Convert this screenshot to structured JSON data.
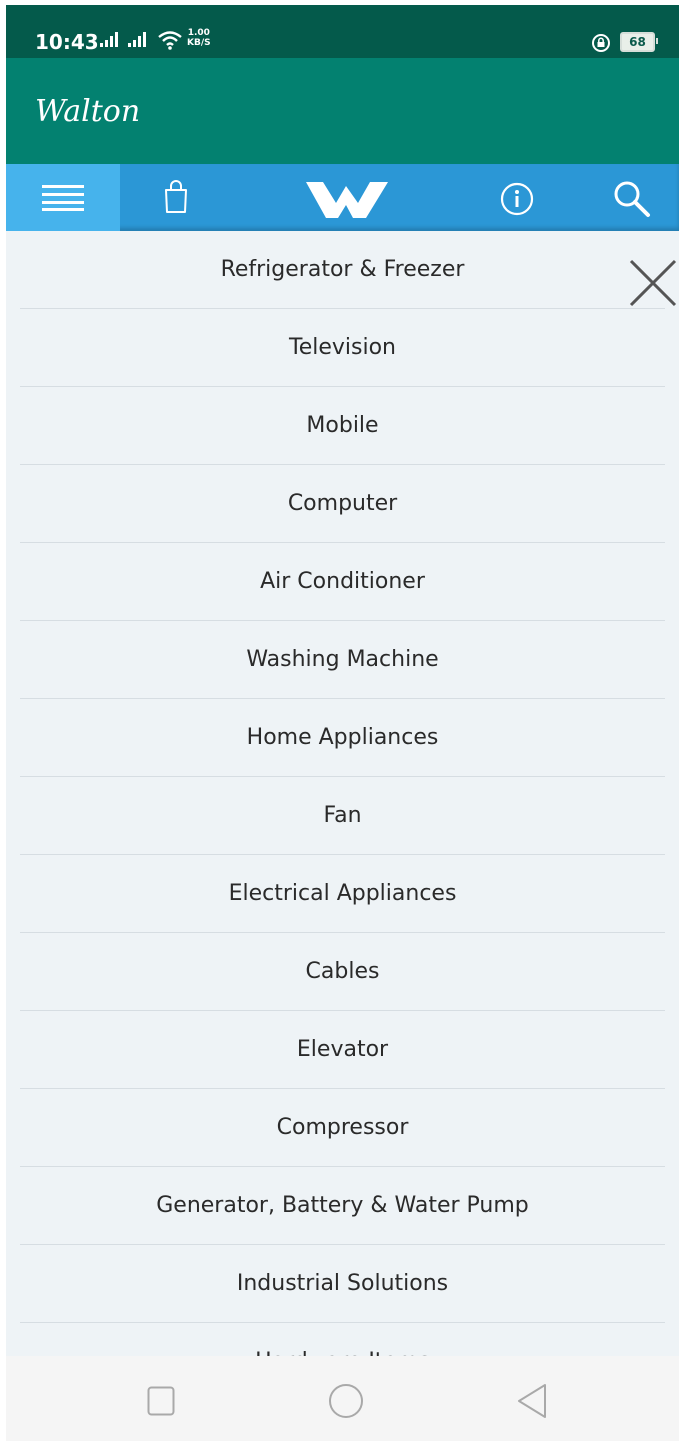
{
  "status_bar": {
    "time": "10:43",
    "net_speed_value": "1.00",
    "net_speed_unit": "KB/S",
    "battery": "68",
    "icons": [
      "signal-icon",
      "signal-icon",
      "wifi-icon",
      "rotation-lock-icon",
      "battery-icon"
    ]
  },
  "app_bar": {
    "title": "Walton"
  },
  "nav": {
    "items": [
      {
        "icon": "menu-icon"
      },
      {
        "icon": "shopping-bag-icon"
      },
      {
        "icon": "walton-logo"
      },
      {
        "icon": "info-icon"
      },
      {
        "icon": "search-icon"
      }
    ]
  },
  "menu": {
    "close_icon": "close-icon",
    "items": [
      "Refrigerator & Freezer",
      "Television",
      "Mobile",
      "Computer",
      "Air Conditioner",
      "Washing Machine",
      "Home Appliances",
      "Fan",
      "Electrical Appliances",
      "Cables",
      "Elevator",
      "Compressor",
      "Generator, Battery & Water Pump",
      "Industrial Solutions",
      "Hardware Items"
    ]
  },
  "system_nav": {
    "items": [
      "recents-square-icon",
      "home-circle-icon",
      "back-triangle-icon"
    ]
  },
  "colors": {
    "status_bar": "#045a4b",
    "app_bar": "#038170",
    "nav_bar": "#2b97d6",
    "nav_active": "#46b3ec",
    "background": "#eef3f6"
  }
}
